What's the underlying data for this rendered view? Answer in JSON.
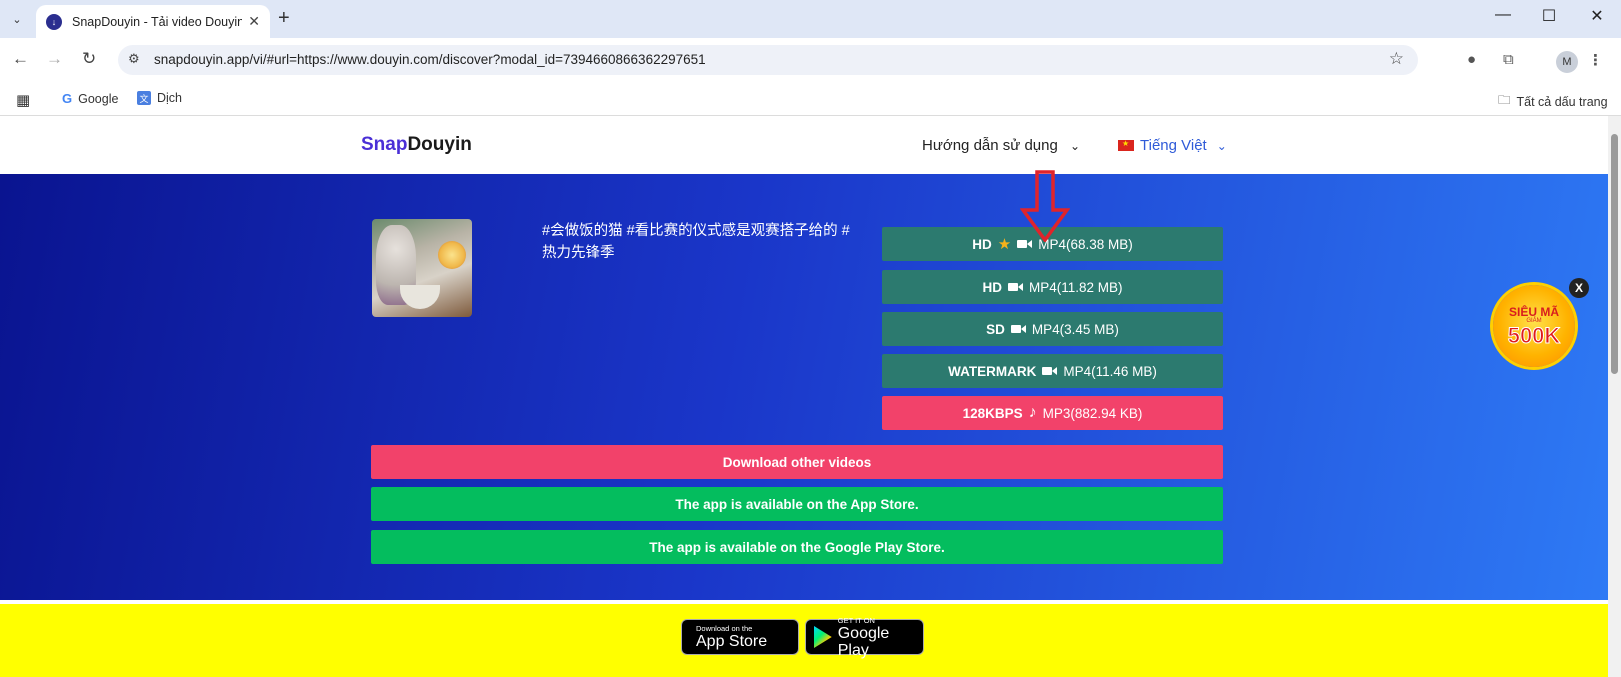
{
  "browser": {
    "tab_title": "SnapDouyin - Tải video Douyin",
    "url": "snapdouyin.app/vi/#url=https://www.douyin.com/discover?modal_id=7394660866362297651",
    "profile_initial": "M",
    "bookmarks": [
      {
        "label": "Google"
      },
      {
        "label": "Dịch"
      }
    ],
    "all_bookmarks_label": "Tất cả dấu trang"
  },
  "site": {
    "logo_snap": "Snap",
    "logo_douyin": "Douyin",
    "nav_guide": "Hướng dẫn sử dụng",
    "nav_language": "Tiếng Việt"
  },
  "video": {
    "caption": "#会做饭的猫 #看比赛的仪式感是观赛搭子给的 #热力先锋季"
  },
  "downloads": [
    {
      "quality": "HD",
      "format": "MP4(68.38 MB)",
      "starred": true,
      "kind": "video"
    },
    {
      "quality": "HD",
      "format": "MP4(11.82 MB)",
      "starred": false,
      "kind": "video"
    },
    {
      "quality": "SD",
      "format": "MP4(3.45 MB)",
      "starred": false,
      "kind": "video"
    },
    {
      "quality": "WATERMARK",
      "format": "MP4(11.46 MB)",
      "starred": false,
      "kind": "video"
    },
    {
      "quality": "128KBPS",
      "format": "MP3(882.94 KB)",
      "starred": false,
      "kind": "audio"
    }
  ],
  "actions": {
    "download_other": "Download other videos",
    "app_store": "The app is available on the App Store.",
    "play_store": "The app is available on the Google Play Store."
  },
  "promo": {
    "line1": "SIÊU MÃ",
    "line_small": "GIẢM",
    "line2": "500K",
    "close": "X"
  },
  "badges": {
    "apple_small": "Download on the",
    "apple_big": "App Store",
    "google_small": "GET IT ON",
    "google_big": "Google Play"
  },
  "colors": {
    "teal_button": "#2c7a6f",
    "pink_button": "#f2426a",
    "green_button": "#04bd5e",
    "hero_start": "#0a1490",
    "hero_end": "#2e7af5",
    "annotation_arrow": "#e0242b"
  }
}
